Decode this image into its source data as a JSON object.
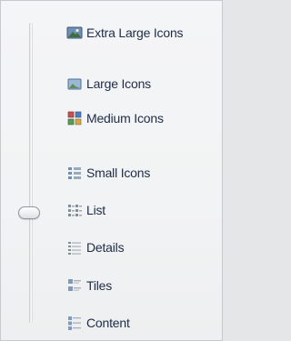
{
  "view_menu": {
    "items": [
      {
        "label": "Extra Large Icons",
        "icon": "extra-large-icons-icon"
      },
      {
        "label": "Large Icons",
        "icon": "large-icons-icon"
      },
      {
        "label": "Medium Icons",
        "icon": "medium-icons-icon"
      },
      {
        "label": "Small Icons",
        "icon": "small-icons-icon"
      },
      {
        "label": "List",
        "icon": "list-icon"
      },
      {
        "label": "Details",
        "icon": "details-icon"
      },
      {
        "label": "Tiles",
        "icon": "tiles-icon"
      },
      {
        "label": "Content",
        "icon": "content-icon"
      }
    ],
    "selected": "List",
    "colors": {
      "text": "#1f2c46",
      "background": "#f2f3f4",
      "border": "#c7cacd",
      "thumb_border": "#8f969e"
    }
  }
}
